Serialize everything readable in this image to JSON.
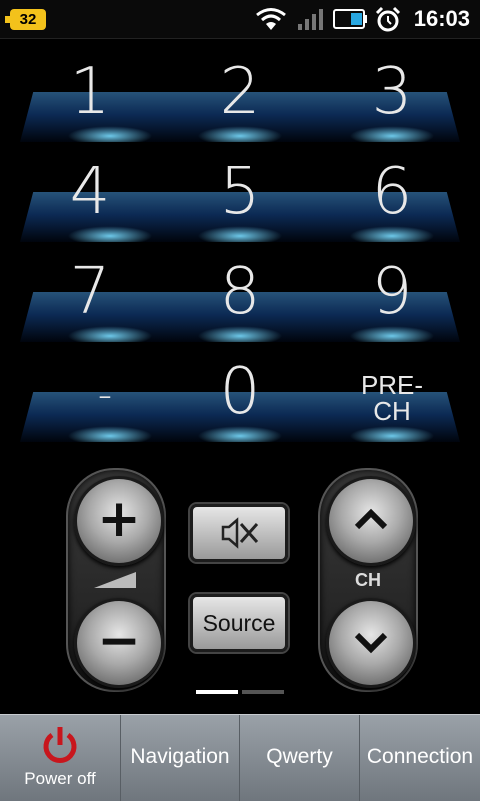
{
  "status_bar": {
    "battery_badge": "32",
    "time": "16:03"
  },
  "keypad": {
    "rows": [
      [
        "1",
        "2",
        "3"
      ],
      [
        "4",
        "5",
        "6"
      ],
      [
        "7",
        "8",
        "9"
      ],
      [
        "-",
        "0",
        "PRE-CH"
      ]
    ],
    "prech_line1": "PRE-",
    "prech_line2": "CH"
  },
  "controls": {
    "volume_up": "+",
    "volume_down": "−",
    "mute_icon": "mute-icon",
    "source_label": "Source",
    "channel_label": "CH"
  },
  "pager": {
    "current_page": 1,
    "total_pages": 2
  },
  "tabs": [
    {
      "label": "Power off",
      "icon": "power-icon"
    },
    {
      "label": "Navigation"
    },
    {
      "label": "Qwerty"
    },
    {
      "label": "Connection"
    }
  ],
  "colors": {
    "power_icon": "#c8161d",
    "keypad_glow": "#2a8be0",
    "battery_badge": "#f3c21b"
  }
}
